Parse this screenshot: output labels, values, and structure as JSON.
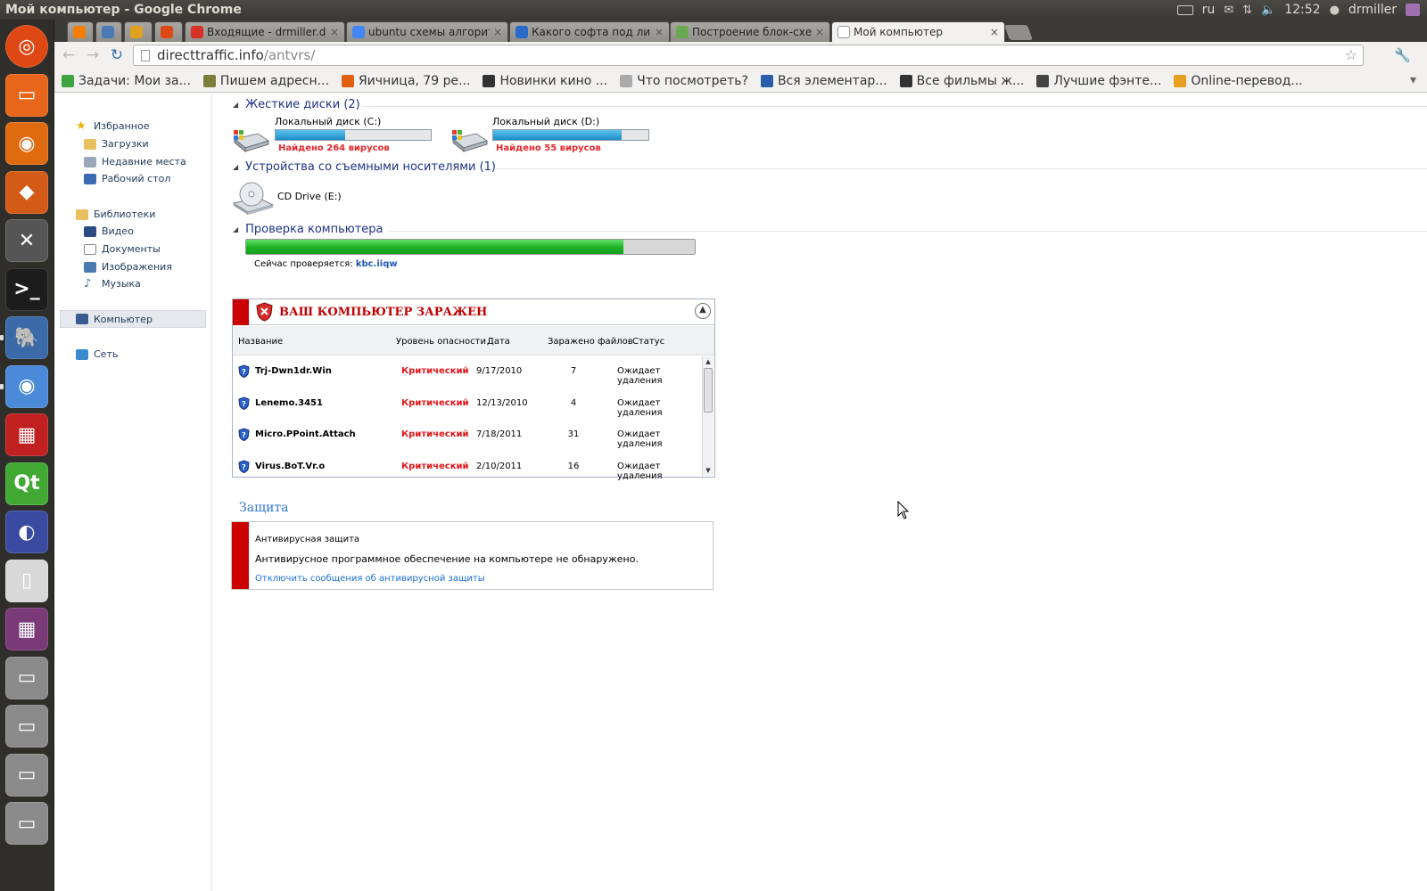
{
  "os": {
    "window_title": "Мой компьютер - Google Chrome",
    "tray": {
      "keyboard_layout": "ru",
      "clock": "12:52",
      "user": "drmiller"
    }
  },
  "launcher": [
    "ubuntu-icon",
    "files-icon",
    "firefox-icon",
    "software-center-icon",
    "settings-icon",
    "terminal-icon",
    "postgresql-icon",
    "chrome-icon",
    "windows-tiles-icon",
    "qt-icon",
    "eclipse-icon",
    "text-editor-icon",
    "workspace-icon",
    "drive-icon",
    "drive-icon",
    "drive-icon",
    "drive-icon"
  ],
  "tabs": [
    {
      "label": "",
      "icon": "blogger-icon",
      "color": "#f57d00"
    },
    {
      "label": "",
      "icon": "pic-icon",
      "color": "#4a7ab5"
    },
    {
      "label": "",
      "icon": "pa-icon",
      "color": "#e0a020"
    },
    {
      "label": "",
      "icon": "ubuntu-icon",
      "color": "#dd4814"
    },
    {
      "label": "Входящие - drmiller.de",
      "icon": "gmail-icon",
      "color": "#d93025"
    },
    {
      "label": "ubuntu схемы алгорит",
      "icon": "google-icon",
      "color": "#4285f4"
    },
    {
      "label": "Какого софта под лин",
      "icon": "gear-icon",
      "color": "#2a6ac8"
    },
    {
      "label": "Построение блок-схем",
      "icon": "leaf-icon",
      "color": "#6aa84f"
    },
    {
      "label": "Мой компьютер",
      "icon": "page-icon",
      "color": "#ffffff"
    }
  ],
  "address": {
    "host": "directtraffic.info",
    "path": "/antvrs/"
  },
  "bookmarks": [
    {
      "label": "Задачи: Мои за...",
      "color": "#3fa33f"
    },
    {
      "label": "Пишем адресн...",
      "color": "#7d7d3a"
    },
    {
      "label": "Яичница, 79 ре...",
      "color": "#e06010"
    },
    {
      "label": "Новинки кино ...",
      "color": "#333333"
    },
    {
      "label": "Что посмотреть?",
      "color": "#aaaaaa"
    },
    {
      "label": "Вся элементар...",
      "color": "#2a5ea8"
    },
    {
      "label": "Все фильмы ж...",
      "color": "#333333"
    },
    {
      "label": "Лучшие фэнте...",
      "color": "#444444"
    },
    {
      "label": "Online-перевод...",
      "color": "#e8a020"
    }
  ],
  "nav": {
    "favorites": "Избранное",
    "downloads": "Загрузки",
    "recent": "Недавние места",
    "desktop": "Рабочий стол",
    "libraries": "Библиотеки",
    "video": "Видео",
    "documents": "Документы",
    "images": "Изображения",
    "music": "Музыка",
    "computer": "Компьютер",
    "network": "Сеть"
  },
  "sections": {
    "hard_disks": "Жесткие диски (2)",
    "removable": "Устройства со съемными носителями (1)",
    "scan": "Проверка компьютера"
  },
  "drives": [
    {
      "label": "Локальный диск (C:)",
      "warning": "Найдено 264 вирусов",
      "fill": 0.45
    },
    {
      "label": "Локальный диск (D:)",
      "warning": "Найдено 55 вирусов",
      "fill": 0.83
    }
  ],
  "cd_drive": "CD Drive (E:)",
  "scan": {
    "progress": 0.84,
    "label": "Сейчас проверяется:",
    "file": "kbc.iiqw"
  },
  "infection": {
    "title": "ВАШ КОМПЬЮТЕР ЗАРАЖЕН",
    "columns": {
      "name": "Название",
      "level": "Уровень опасности",
      "date": "Дата",
      "files": "Заражено файлов",
      "status": "Статус"
    },
    "rows": [
      {
        "name": "Trj-Dwn1dr.Win",
        "level": "Критический",
        "date": "9/17/2010",
        "files": "7",
        "status": "Ожидает удаления"
      },
      {
        "name": "Lenemo.3451",
        "level": "Критический",
        "date": "12/13/2010",
        "files": "4",
        "status": "Ожидает удаления"
      },
      {
        "name": "Micro.PPoint.Attach",
        "level": "Критический",
        "date": "7/18/2011",
        "files": "31",
        "status": "Ожидает удаления"
      },
      {
        "name": "Virus.BoT.Vr.o",
        "level": "Критический",
        "date": "2/10/2011",
        "files": "16",
        "status": "Ожидает удаления"
      }
    ]
  },
  "protection": {
    "title": "Защита",
    "heading": "Антивирусная защита",
    "message": "Антивирусное программное обеспечение на компьютере не обнаружено.",
    "link": "Отключить сообщения об антивирусной защиты"
  },
  "colors": {
    "danger": "#e3151a",
    "accent": "#c00000",
    "link": "#1a6fd6",
    "progress": "#1fb127"
  }
}
